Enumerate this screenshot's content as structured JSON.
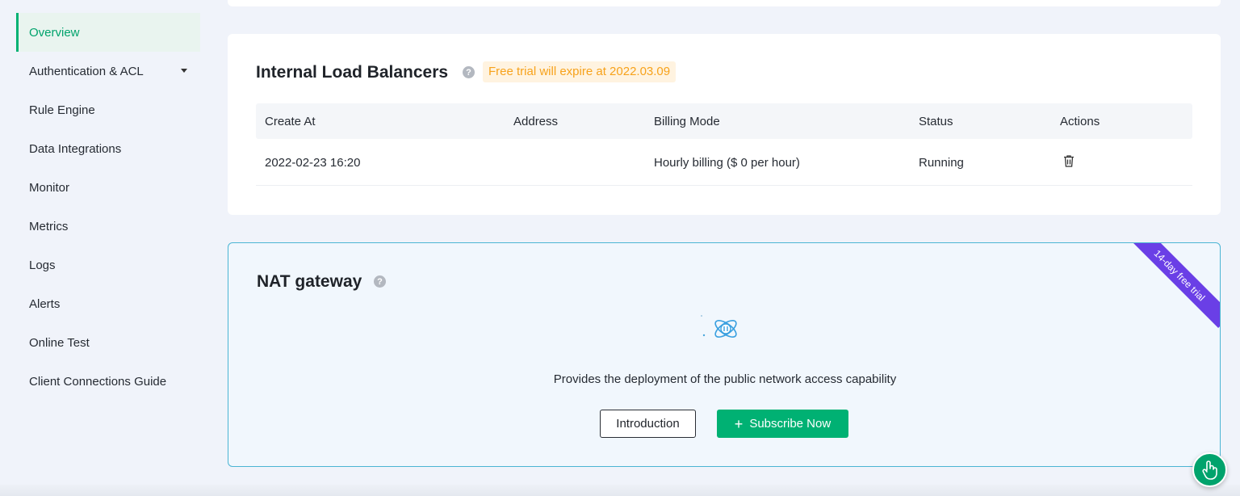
{
  "sidebar": {
    "items": [
      {
        "label": "Overview",
        "active": true
      },
      {
        "label": "Authentication & ACL",
        "has_caret": true
      },
      {
        "label": "Rule Engine"
      },
      {
        "label": "Data Integrations"
      },
      {
        "label": "Monitor"
      },
      {
        "label": "Metrics"
      },
      {
        "label": "Logs"
      },
      {
        "label": "Alerts"
      },
      {
        "label": "Online Test"
      },
      {
        "label": "Client Connections Guide"
      }
    ]
  },
  "ilb": {
    "title": "Internal Load Balancers",
    "help_icon": "question-icon",
    "trial_tag": "Free trial will expire at 2022.03.09",
    "columns": [
      "Create At",
      "Address",
      "Billing Mode",
      "Status",
      "Actions"
    ],
    "rows": [
      {
        "create_at": "2022-02-23 16:20",
        "address": "",
        "billing_mode": "Hourly billing ($ 0 per hour)",
        "status": "Running",
        "action_icon": "trash-icon"
      }
    ]
  },
  "nat": {
    "title": "NAT gateway",
    "ribbon": "14-day free trial",
    "description": "Provides the deployment of the public network access capability",
    "intro_button": "Introduction",
    "subscribe_button": "Subscribe Now",
    "subscribe_icon": "plus-icon"
  },
  "colors": {
    "accent": "#00b173",
    "tag_text": "#f7a21b",
    "ribbon": "#6a3fe6",
    "nat_border": "#4bb5d4"
  }
}
